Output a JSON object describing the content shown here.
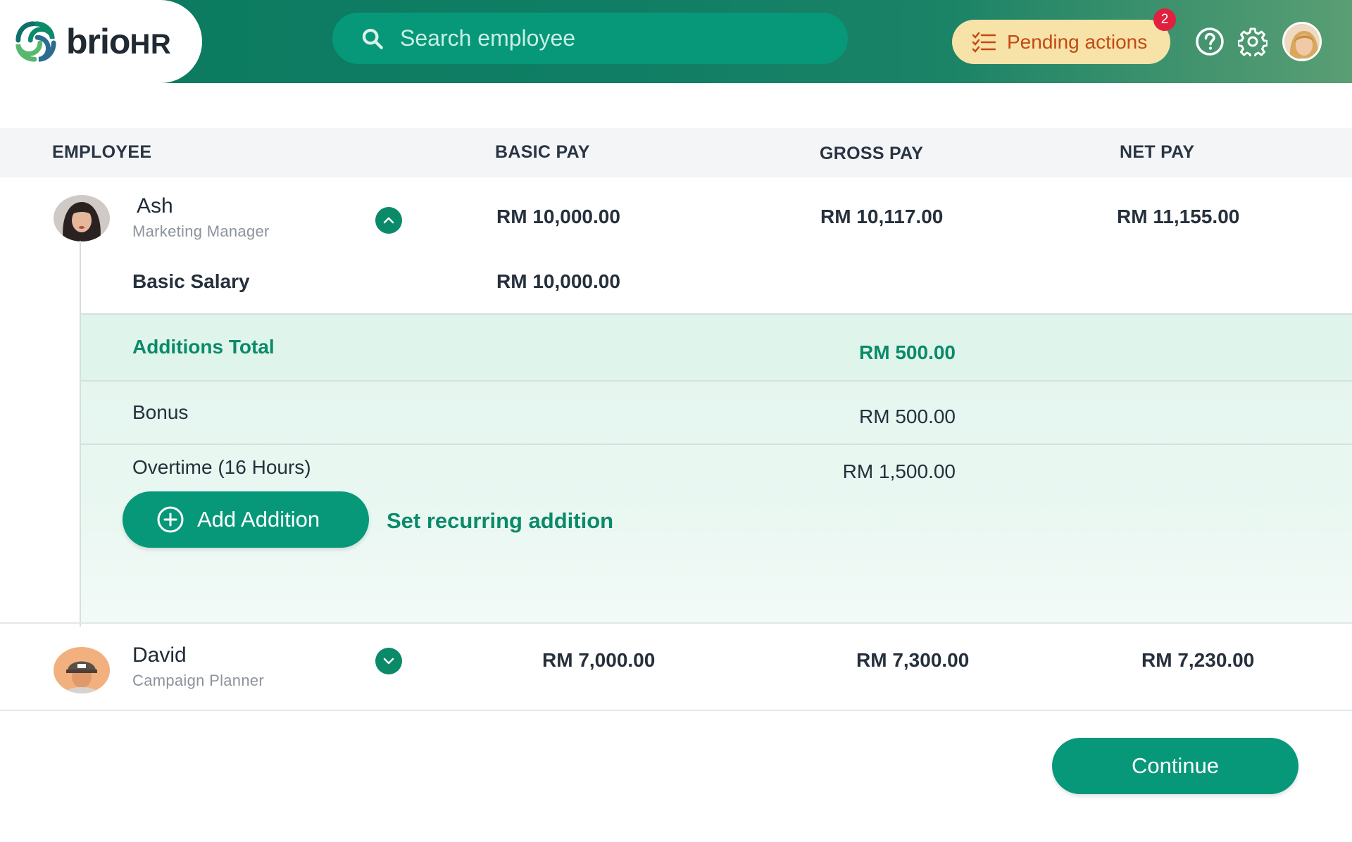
{
  "header": {
    "brand": {
      "name_part1": "brio",
      "name_part2": "HR"
    },
    "search": {
      "placeholder": "Search employee"
    },
    "pending": {
      "label": "Pending actions",
      "count": "2"
    }
  },
  "table": {
    "columns": [
      "EMPLOYEE",
      "BASIC PAY",
      "GROSS PAY",
      "NET PAY"
    ],
    "employees": [
      {
        "name": "Ash",
        "role": "Marketing Manager",
        "basic_pay": "RM 10,000.00",
        "gross_pay": "RM 10,117.00",
        "net_pay": "RM 11,155.00",
        "expanded": true,
        "details": {
          "basic_salary_label": "Basic Salary",
          "basic_salary_value": "RM 10,000.00",
          "additions_total_label": "Additions Total",
          "additions_total_value": "RM 500.00",
          "additions": [
            {
              "label": "Bonus",
              "value": "RM 500.00"
            },
            {
              "label": "Overtime (16 Hours)",
              "value": "RM 1,500.00"
            }
          ],
          "add_addition_label": "Add Addition",
          "recurring_label": "Set recurring addition"
        }
      },
      {
        "name": "David",
        "role": "Campaign Planner",
        "basic_pay": "RM 7,000.00",
        "gross_pay": "RM 7,300.00",
        "net_pay": "RM 7,230.00",
        "expanded": false
      }
    ]
  },
  "footer": {
    "continue_label": "Continue"
  },
  "colors": {
    "brand_green": "#07987a",
    "accent_green": "#0b8a6a",
    "pending_bg": "#f7e2a8",
    "pending_text": "#c24a13",
    "badge": "#e0203f"
  }
}
